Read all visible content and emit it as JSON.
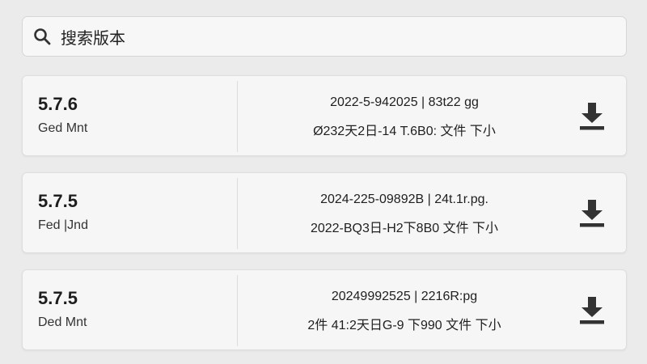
{
  "search": {
    "value": "搜索版本",
    "icon": "search-icon"
  },
  "versions": [
    {
      "version": "5.7.6",
      "status": "Ged Mnt",
      "line1": "2022-5-942025 | 83t22 gg",
      "line2": "Ø232天2日-14 T.6B0: 文件 下小",
      "icon": "download-icon"
    },
    {
      "version": "5.7.5",
      "status": "Fed |Jnd",
      "line1": "2024-225-09892B | 24t.1r.pg.",
      "line2": "2022-BQ3日-H2下8B0 文件 下小",
      "icon": "download-icon"
    },
    {
      "version": "5.7.5",
      "status": "Ded Mnt",
      "line1": "20249992525 | 2216R:pg",
      "line2": "2件 41:2天日G-9 下990 文件 下小",
      "icon": "download-icon"
    }
  ],
  "colors": {
    "background": "#ebebeb",
    "card": "#f6f6f6",
    "text": "#222222",
    "icon": "#333333"
  }
}
